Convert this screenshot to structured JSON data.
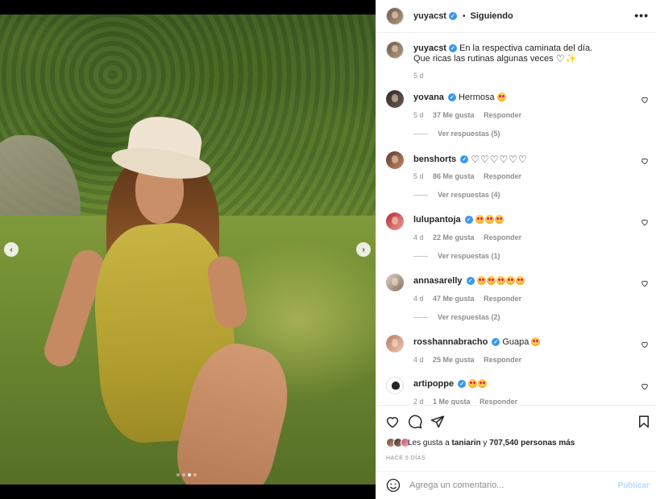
{
  "post": {
    "author": "yuyacst",
    "follow_status": "Siguiendo",
    "separator": "•",
    "more_glyph": "•••",
    "caption_line1": "En la respectiva caminata del día.",
    "caption_line2": "Que ricas las rutinas algunas veces",
    "caption_age": "5 d"
  },
  "comments": [
    {
      "user": "yovana",
      "text": "Hermosa",
      "emoji_count": 1,
      "age": "5 d",
      "likes": "37 Me gusta",
      "reply": "Responder",
      "replies": "Ver respuestas (5)"
    },
    {
      "user": "benshorts",
      "text": "",
      "emoji_count": 0,
      "hearts": "♡♡♡♡♡♡",
      "age": "5 d",
      "likes": "86 Me gusta",
      "reply": "Responder",
      "replies": "Ver respuestas (4)"
    },
    {
      "user": "lulupantoja",
      "text": "",
      "emoji_count": 3,
      "age": "4 d",
      "likes": "22 Me gusta",
      "reply": "Responder",
      "replies": "Ver respuestas (1)"
    },
    {
      "user": "annasarelly",
      "text": "",
      "emoji_count": 5,
      "age": "4 d",
      "likes": "47 Me gusta",
      "reply": "Responder",
      "replies": "Ver respuestas (2)"
    },
    {
      "user": "rosshannabracho",
      "text": "Guapa",
      "emoji_count": 1,
      "age": "4 d",
      "likes": "25 Me gusta",
      "reply": "Responder",
      "replies": ""
    },
    {
      "user": "artipoppe",
      "text": "",
      "emoji_count": 2,
      "age": "2 d",
      "likes": "1 Me gusta",
      "reply": "Responder",
      "replies": ""
    }
  ],
  "likes": {
    "prefix": "Les gusta a",
    "user": "taniarin",
    "middle": "y",
    "count": "707,540 personas más"
  },
  "timestamp": "HACE 5 DÍAS",
  "add_comment": {
    "placeholder": "Agrega un comentario...",
    "publish": "Publicar"
  },
  "carousel": {
    "prev": "‹",
    "next": "›",
    "slide_count": 4,
    "active_slide": 3
  },
  "colors": {
    "verified": "#3897f0",
    "publish_disabled": "#b3dbff",
    "muted_text": "#8e8e8e"
  },
  "icons": [
    "verified-icon",
    "more-options-icon",
    "like-heart-icon",
    "comment-icon",
    "share-icon",
    "save-bookmark-icon",
    "emoji-icon",
    "chevron-left-icon",
    "chevron-right-icon"
  ]
}
